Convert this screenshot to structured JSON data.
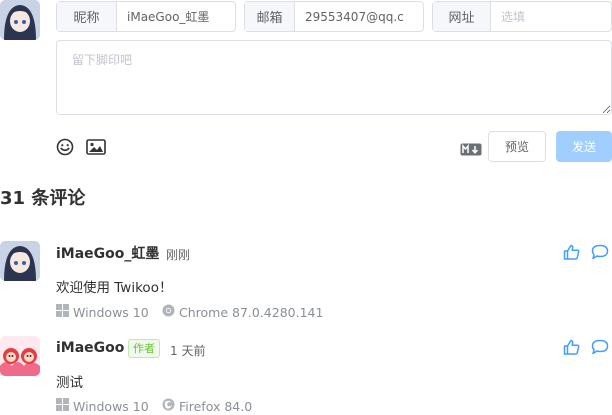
{
  "form": {
    "nick_label": "昵称",
    "nick_value": "iMaeGoo_虹墨",
    "mail_label": "邮箱",
    "mail_value": "29553407@qq.c",
    "link_label": "网址",
    "link_placeholder": "选填",
    "comment_placeholder": "留下脚印吧",
    "preview_label": "预览",
    "send_label": "发送",
    "emoji_icon": "smiley-face-icon",
    "image_icon": "image-icon",
    "markdown_icon": "markdown-icon"
  },
  "comments_count": "31 条评论",
  "comments": [
    {
      "nick": "iMaeGoo_虹墨",
      "time": "刚刚",
      "content": "欢迎使用 Twikoo！",
      "os": "Windows 10",
      "browser": "Chrome 87.0.4280.141"
    },
    {
      "nick": "iMaeGoo",
      "badge": "作者",
      "time": "1 天前",
      "content": "测试",
      "os": "Windows 10",
      "browser": "Firefox 84.0"
    }
  ],
  "colors": {
    "accent": "#409eff",
    "send_disabled_bg": "#a0cfff",
    "badge_green": "#67c23a"
  }
}
